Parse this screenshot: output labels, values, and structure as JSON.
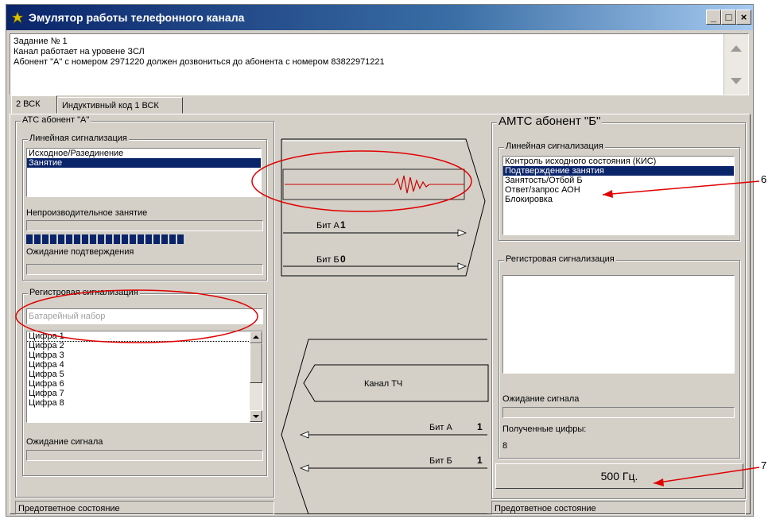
{
  "window": {
    "title": "Эмулятор работы телефонного канала"
  },
  "task": {
    "line1": "Задание № 1",
    "line2": "Канал работает на уровене ЗСЛ",
    "line3": "Абонент \"А\" с номером 2971220 должен дозвониться до абонента с номером 83822971221"
  },
  "tabs": [
    {
      "label": "2 ВСК"
    },
    {
      "label": "Индуктивный код 1 ВСК"
    }
  ],
  "left": {
    "group_title": "АТС   абонент \"А\"",
    "line_sig_title": "Линейная сигнализация",
    "line_sig_items": [
      "Исходное/Разединение",
      "Занятие"
    ],
    "line_sig_selected": 1,
    "unproductive_label": "Непроизводительное занятие",
    "progress_blocks": 20,
    "await_confirm_label": "Ожидание подтверждения",
    "reg_sig_title": "Регистровая сигнализация",
    "dial_placeholder": "Батарейный набор",
    "digits": [
      "Цифра 1",
      "Цифра 2",
      "Цифра 3",
      "Цифра 4",
      "Цифра 5",
      "Цифра 6",
      "Цифра 7",
      "Цифра 8"
    ],
    "await_signal_label": "Ожидание сигнала",
    "status": "Предответное состояние"
  },
  "center": {
    "bitA_fwd_label": "Бит А",
    "bitA_fwd_value": "1",
    "bitB_fwd_label": "Бит Б",
    "bitB_fwd_value": "0",
    "channel_label": "Канал ТЧ",
    "bitA_back_label": "Бит А",
    "bitA_back_value": "1",
    "bitB_back_label": "Бит Б",
    "bitB_back_value": "1"
  },
  "right": {
    "group_title": "АМТС  абонент \"Б\"",
    "line_sig_title": "Линейная сигнализация",
    "line_sig_items": [
      "Контроль исходного состояния (КИС)",
      "Подтверждение занятия",
      "Занятость/Отбой Б",
      "Ответ/запрос АОН",
      "Блокировка"
    ],
    "line_sig_selected": 1,
    "reg_sig_title": "Регистровая сигнализация",
    "await_signal_label": "Ожидание сигнала",
    "received_digits_label": "Полученные цифры:",
    "received_digits_value": "8",
    "freq_button": "500 Гц.",
    "status": "Предответное состояние"
  },
  "annotations": {
    "mark6": "6",
    "mark7": "7",
    "accent": "#e00000"
  }
}
